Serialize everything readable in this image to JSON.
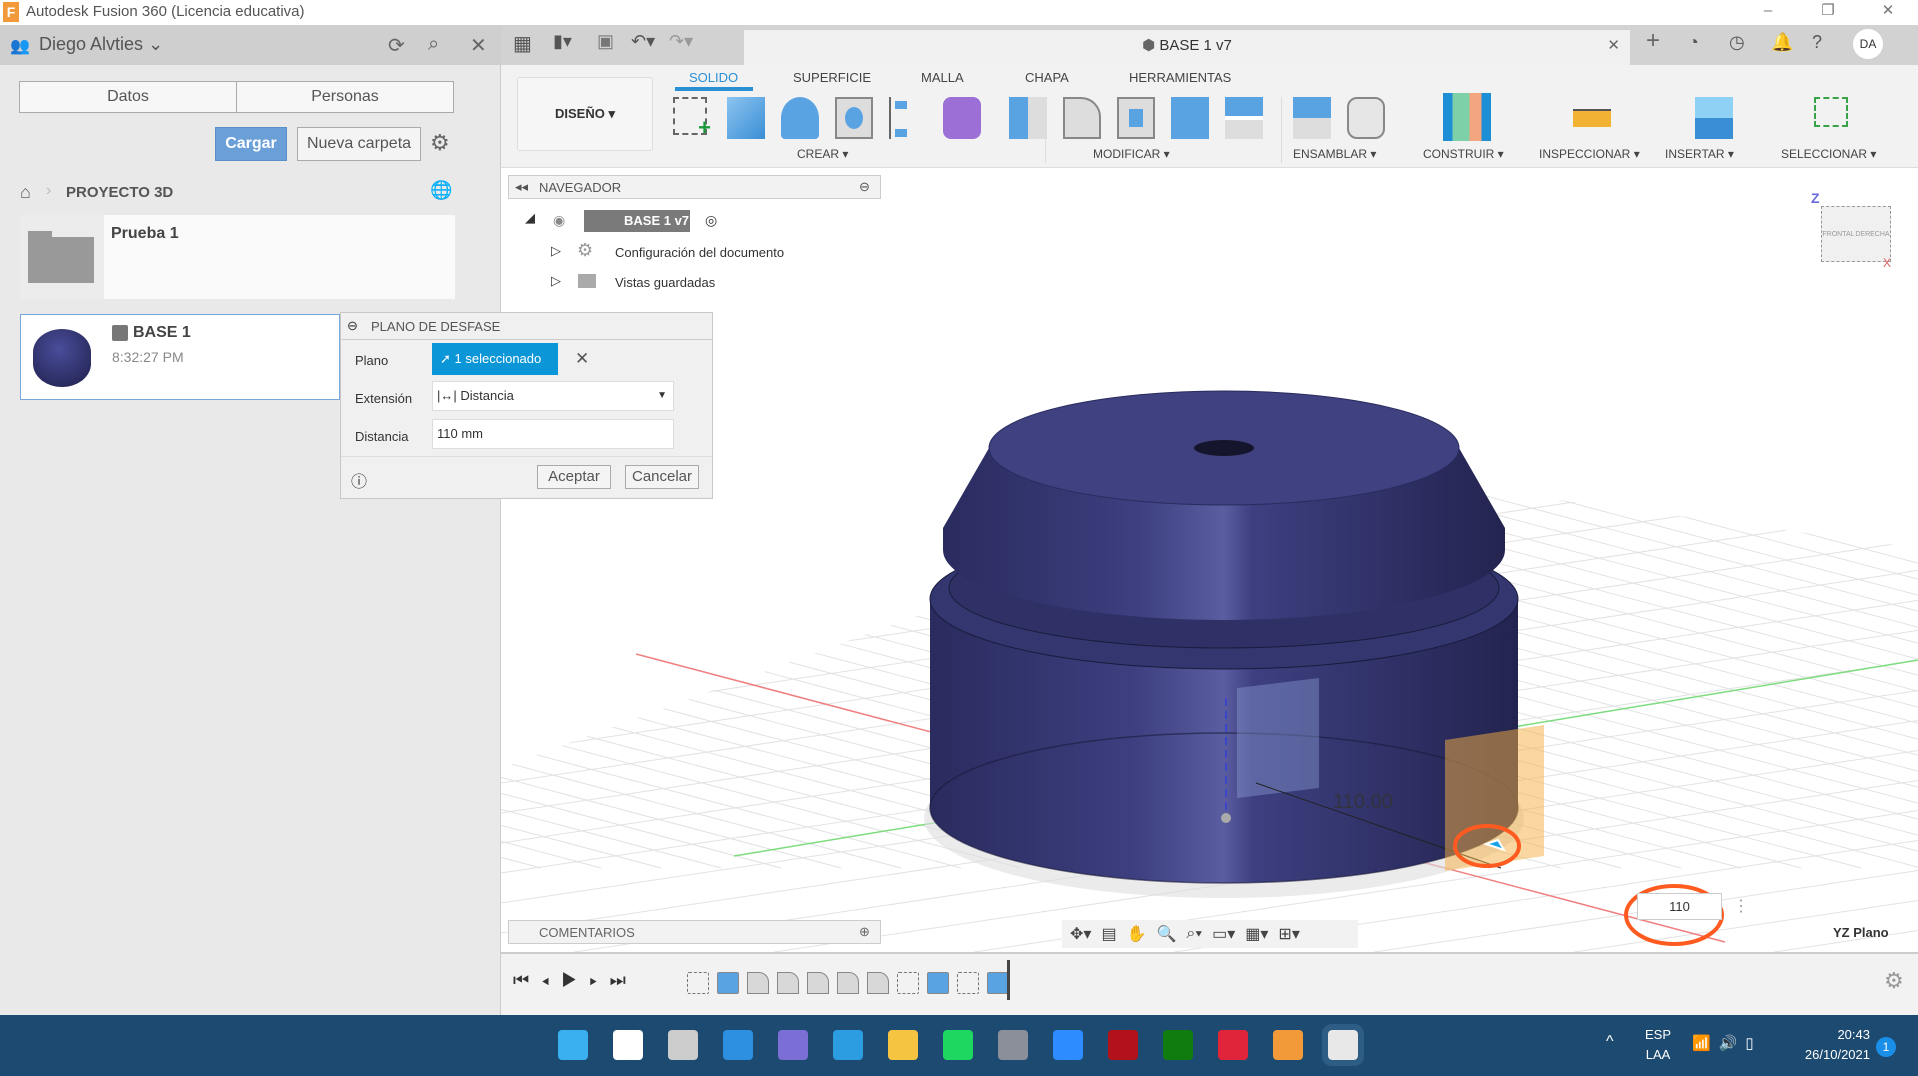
{
  "window": {
    "title": "Autodesk Fusion 360 (Licencia educativa)"
  },
  "left_panel": {
    "user": "Diego Alvties",
    "tabs": [
      "Datos",
      "Personas"
    ],
    "upload_label": "Cargar",
    "new_folder_label": "Nueva carpeta",
    "breadcrumb": "PROYECTO 3D",
    "items": [
      {
        "name": "Prueba 1",
        "type": "folder"
      },
      {
        "name": "BASE 1",
        "time": "8:32:27 PM",
        "type": "design"
      }
    ]
  },
  "document_tab": {
    "title": "BASE 1 v7",
    "avatar": "DA"
  },
  "toolbar": {
    "workspace": "DISEÑO",
    "tabs": [
      "SOLIDO",
      "SUPERFICIE",
      "MALLA",
      "CHAPA",
      "HERRAMIENTAS"
    ],
    "active_tab": "SOLIDO",
    "groups": [
      "CREAR",
      "MODIFICAR",
      "ENSAMBLAR",
      "CONSTRUIR",
      "INSPECCIONAR",
      "INSERTAR",
      "SELECCIONAR"
    ]
  },
  "browser": {
    "title": "NAVEGADOR",
    "root": "BASE 1 v7",
    "items": [
      "Configuración del documento",
      "Vistas guardadas"
    ]
  },
  "dialog": {
    "title": "PLANO DE DESFASE",
    "plane_label": "Plano",
    "plane_value": "1 seleccionado",
    "extent_label": "Extensión",
    "extent_value": "Distancia",
    "distance_label": "Distancia",
    "distance_value": "110 mm",
    "ok": "Aceptar",
    "cancel": "Cancelar"
  },
  "viewport": {
    "dimension_label": "110.00",
    "dimension_input": "110",
    "plane_name": "YZ Plano",
    "viewcube": {
      "front": "FRONTAL",
      "right": "DERECHA",
      "z": "Z",
      "x": "X"
    },
    "model_color": "#3b3d78",
    "plane_color": "#f5b041",
    "annotation_color": "#ff5a1f"
  },
  "comments": {
    "title": "COMENTARIOS"
  },
  "taskbar": {
    "lang1": "ESP",
    "lang2": "LAA",
    "time": "20:43",
    "date": "26/10/2021",
    "notifications": "1",
    "apps": [
      {
        "name": "start",
        "color": "#3bb0f0"
      },
      {
        "name": "search",
        "color": "#ffffff"
      },
      {
        "name": "task-view",
        "color": "#cccccc"
      },
      {
        "name": "widgets",
        "color": "#2d8fe0"
      },
      {
        "name": "teams",
        "color": "#7b6fd6"
      },
      {
        "name": "edge",
        "color": "#2b9de0"
      },
      {
        "name": "file-explorer",
        "color": "#f5c542"
      },
      {
        "name": "spotify",
        "color": "#1ed760"
      },
      {
        "name": "settings",
        "color": "#8a8f99"
      },
      {
        "name": "zoom",
        "color": "#2d8cff"
      },
      {
        "name": "red-app",
        "color": "#b3121b"
      },
      {
        "name": "xbox",
        "color": "#107c10"
      },
      {
        "name": "opera",
        "color": "#e0243a"
      },
      {
        "name": "fusion-360",
        "color": "#f29a3a"
      },
      {
        "name": "snipping-tool",
        "color": "#e8e8e8"
      }
    ]
  }
}
